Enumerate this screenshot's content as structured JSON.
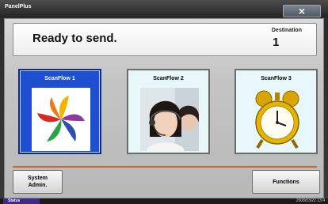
{
  "window": {
    "title": "PanelPlus",
    "close_label": "×"
  },
  "status": {
    "message": "Ready to send.",
    "destination_label": "Destination",
    "destination_count": "1"
  },
  "flows": [
    {
      "title": "ScanFlow 1",
      "image": "pinwheel-logo",
      "selected": true
    },
    {
      "title": "ScanFlow 2",
      "image": "headset-operator-photo",
      "selected": false
    },
    {
      "title": "ScanFlow 3",
      "image": "alarm-clock",
      "selected": false
    }
  ],
  "buttons": {
    "system_admin": "System\nAdmin.",
    "functions": "Functions"
  },
  "statusbar": {
    "tab_label": "Status",
    "datetime": "2008/03/22 13:4"
  },
  "colors": {
    "selected_tile": "#1e4fd0",
    "tile_background": "#e8f7fa",
    "divider": "#c76a3a"
  }
}
